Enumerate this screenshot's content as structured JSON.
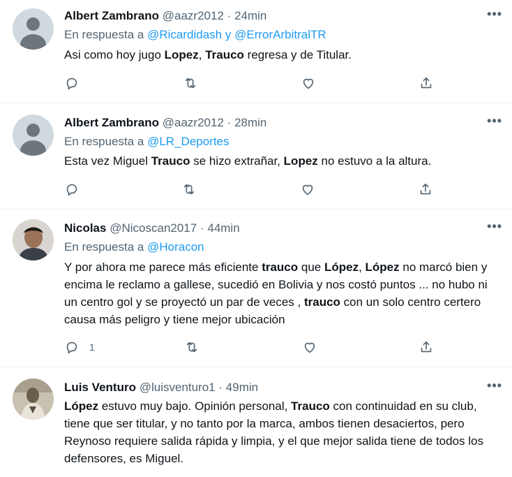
{
  "tweets": [
    {
      "name": "Albert Zambrano",
      "handle": "@aazr2012",
      "sep": "·",
      "time": "24min",
      "reply_prefix": "En respuesta a",
      "mention1": "@Ricardidash",
      "reply_join": "y",
      "mention2": "@ErrorArbitralTR",
      "text": [
        {
          "t": "Asi como hoy jugo "
        },
        {
          "t": "Lopez",
          "b": true
        },
        {
          "t": ", "
        },
        {
          "t": "Trauco",
          "b": true
        },
        {
          "t": " regresa y de Titular."
        }
      ]
    },
    {
      "name": "Albert Zambrano",
      "handle": "@aazr2012",
      "sep": "·",
      "time": "28min",
      "reply_prefix": "En respuesta a",
      "mention1": "@LR_Deportes",
      "text": [
        {
          "t": "Esta vez Miguel "
        },
        {
          "t": "Trauco",
          "b": true
        },
        {
          "t": " se hizo extrañar, "
        },
        {
          "t": "Lopez",
          "b": true
        },
        {
          "t": " no estuvo a la altura."
        }
      ]
    },
    {
      "name": "Nicolas",
      "handle": "@Nicoscan2017",
      "sep": "·",
      "time": "44min",
      "reply_prefix": "En respuesta a",
      "mention1": "@Horacon",
      "reply_count": "1",
      "text": [
        {
          "t": "Y por ahora me parece más eficiente "
        },
        {
          "t": "trauco",
          "b": true
        },
        {
          "t": " que "
        },
        {
          "t": "López",
          "b": true
        },
        {
          "t": ", "
        },
        {
          "t": "López",
          "b": true
        },
        {
          "t": " no marcó bien y encima le reclamo a gallese, sucedió en Bolivia y nos costó puntos ... no hubo ni un centro gol y se proyectó un par de veces , "
        },
        {
          "t": "trauco",
          "b": true
        },
        {
          "t": " con un solo centro certero causa más peligro y tiene mejor ubicación"
        }
      ]
    },
    {
      "name": "Luis Venturo",
      "handle": "@luisventuro1",
      "sep": "·",
      "time": "49min",
      "text": [
        {
          "t": "López",
          "b": true
        },
        {
          "t": " estuvo muy bajo. Opinión personal, "
        },
        {
          "t": "Trauco",
          "b": true
        },
        {
          "t": " con continuidad en su club, tiene que ser titular, y no tanto por la marca, ambos tienen desaciertos, pero Reynoso requiere salida rápida y limpia, y el que mejor salida tiene de todos los defensores, es Miguel."
        }
      ]
    }
  ],
  "icons": {
    "more": "more-icon",
    "reply": "reply-icon",
    "retweet": "retweet-icon",
    "like": "like-icon",
    "share": "share-icon"
  },
  "colors": {
    "link": "#1d9bf0",
    "secondary": "#536471",
    "primary": "#0f1419",
    "divider": "#eff3f4"
  }
}
